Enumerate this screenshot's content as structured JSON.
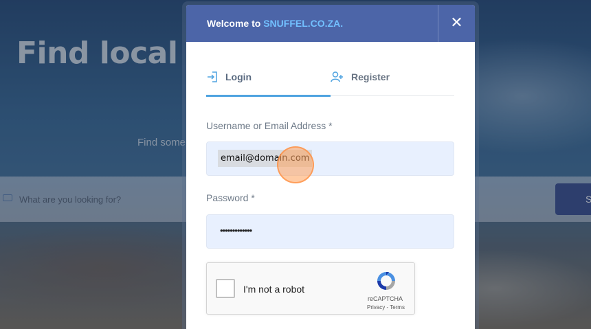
{
  "background": {
    "hero_title": "Find local b                            Brak Ri",
    "hero_subtitle": "Find some                                                                             nd friends.",
    "search": {
      "placeholder": "What are you looking for?",
      "button_label": "S"
    }
  },
  "modal": {
    "title_prefix": "Welcome to ",
    "title_brand": "SNUFFEL.CO.ZA.",
    "close_label": "✕",
    "tabs": [
      {
        "label": "Login",
        "active": true,
        "icon": "login-icon"
      },
      {
        "label": "Register",
        "active": false,
        "icon": "add-user-icon"
      }
    ],
    "form": {
      "username_label": "Username or Email Address *",
      "username_value": "email@domain.com",
      "password_label": "Password *",
      "password_value": "•••••••••••••"
    },
    "recaptcha": {
      "label": "I'm not a robot",
      "brand": "reCAPTCHA",
      "links": "Privacy - Terms"
    }
  },
  "colors": {
    "header_bg": "#4c65a8",
    "brand_accent": "#72c0ff",
    "tab_active_underline": "#4fa3e0",
    "input_bg": "#e8f0fe",
    "click_marker": "#ffa05a"
  }
}
